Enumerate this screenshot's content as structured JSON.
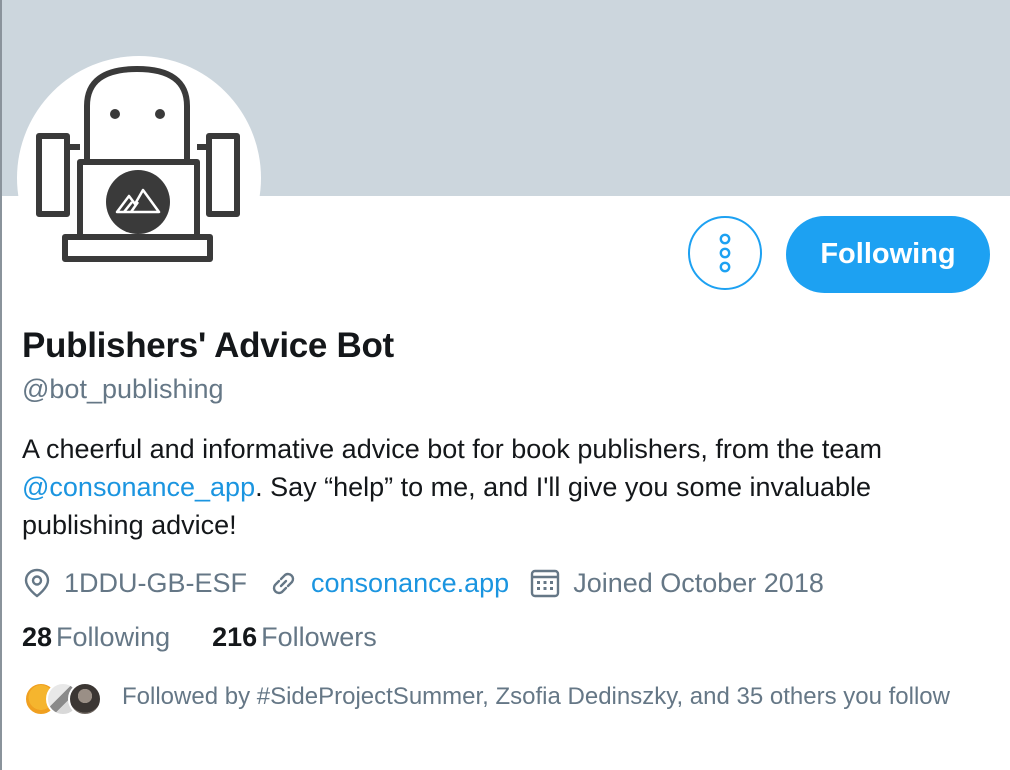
{
  "profile": {
    "display_name": "Publishers' Advice Bot",
    "handle": "@bot_publishing",
    "bio_before": "A cheerful and informative advice bot for book publishers, from the team ",
    "bio_mention": "@consonance_app",
    "bio_after": ". Say “help” to me, and I'll give you some invaluable publishing advice!"
  },
  "actions": {
    "more_icon": "vertical-ellipsis-icon",
    "follow_label": "Following"
  },
  "meta": {
    "location": "1DDU-GB-ESF",
    "website": "consonance.app",
    "joined": "Joined October 2018"
  },
  "stats": {
    "following_count": "28",
    "following_label": "Following",
    "followers_count": "216",
    "followers_label": "Followers"
  },
  "followed_by": {
    "text": "Followed by #SideProjectSummer, Zsofia Dedinszky, and 35 others you follow"
  },
  "colors": {
    "accent": "#1da1f2",
    "banner": "#ccd6dd",
    "secondary_text": "#657786"
  }
}
